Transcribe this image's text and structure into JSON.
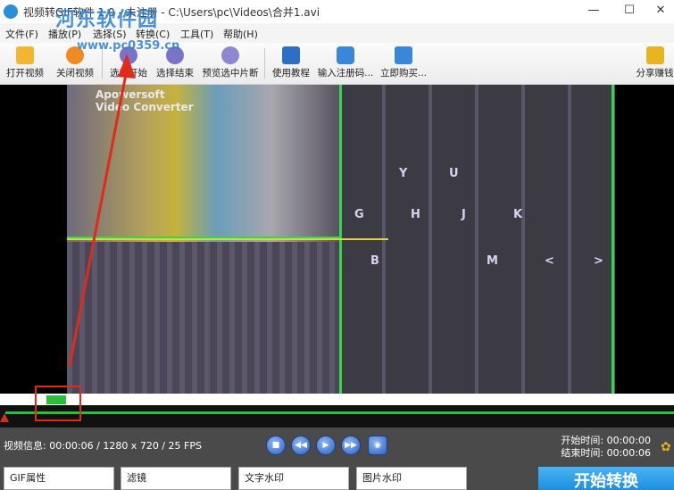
{
  "window": {
    "title": "视频转GIF软件 1.0 - 未注册 - C:\\Users\\pc\\Videos\\合并1.avi",
    "minimize": "—",
    "maximize": "☐",
    "close": "✕"
  },
  "watermark": {
    "text": "河东软件园",
    "url": "www.pc0359.cn"
  },
  "menu": {
    "items": [
      "文件(F)",
      "播放(P)",
      "选择(S)",
      "转换(C)",
      "工具(T)",
      "帮助(H)"
    ]
  },
  "toolbar": {
    "open_video": "打开视频",
    "close_video": "关闭视频",
    "select_start": "选择开始",
    "select_end": "选择结束",
    "preview_selection": "预览选中片断",
    "tutorial": "使用教程",
    "enter_code": "输入注册码...",
    "buy_now": "立即购买...",
    "share": "分享赚钱"
  },
  "video": {
    "inner_title": "Apowersoft",
    "inner_subtitle": "Video Converter",
    "keys": [
      "Y",
      "U",
      "G",
      "H",
      "J",
      "K",
      "B",
      "M",
      "<",
      ">"
    ]
  },
  "info": {
    "video_info_label": "视频信息:",
    "video_info_value": "00:00:06 / 1280 x 720 / 25 FPS",
    "start_time_label": "开始时间:",
    "start_time_value": "00:00:00",
    "end_time_label": "结束时间:",
    "end_time_value": "00:00:06"
  },
  "controls": {
    "stop": "■",
    "rewind": "◀◀",
    "play": "▶",
    "forward": "▶▶",
    "snapshot": "◉"
  },
  "tabs": [
    "GIF属性",
    "滤镜",
    "文字水印",
    "图片水印"
  ],
  "convert_button": "开始转换",
  "colors": {
    "accent": "#1e8fe0",
    "selection": "#2ac13a",
    "annotation": "#e02a1c"
  }
}
